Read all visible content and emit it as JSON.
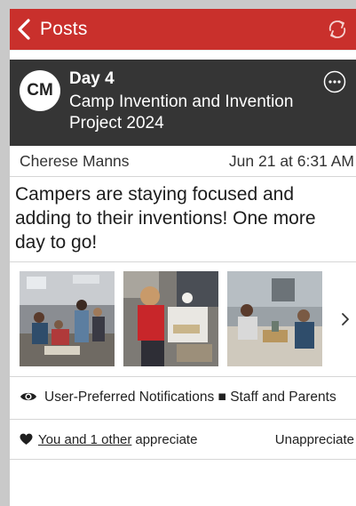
{
  "navbar": {
    "back_icon": "chevron-left-icon",
    "title": "Posts",
    "refresh_icon": "refresh-icon",
    "color": "#c9302c"
  },
  "post": {
    "avatar_initials": "CM",
    "day": "Day 4",
    "group": "Camp Invention and Invention Project 2024",
    "more_icon": "ellipsis-circle-icon",
    "author": "Cherese Manns",
    "date": "Jun 21 at 6:31 AM",
    "body": "Campers are staying focused and adding to their inventions! One more day to go!",
    "photos": [
      {
        "icon": "photo-classroom-students"
      },
      {
        "icon": "photo-girl-crafting"
      },
      {
        "icon": "photo-students-table"
      }
    ],
    "next_icon": "chevron-right-icon",
    "audience_icon": "eye-icon",
    "audience": "User-Preferred Notifications ■ Staff and Parents",
    "appreciation": {
      "heart_icon": "heart-icon",
      "link_text": "You and 1 other",
      "suffix": "appreciate",
      "action": "Unappreciate"
    }
  }
}
